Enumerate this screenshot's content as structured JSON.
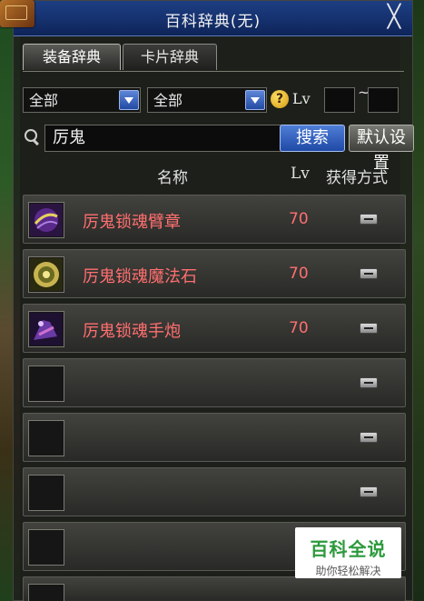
{
  "window": {
    "title": "百科辞典(无)",
    "close_glyph": "╳"
  },
  "tabs": [
    {
      "label": "装备辞典",
      "active": true
    },
    {
      "label": "卡片辞典",
      "active": false
    }
  ],
  "filters": {
    "category_1": "全部",
    "category_2": "全部",
    "help_glyph": "?",
    "lv_label": "Lv",
    "lv_min": "",
    "lv_max": "",
    "range_sep": "~"
  },
  "search": {
    "query": "厉鬼",
    "search_button": "搜索",
    "default_button": "默认设置"
  },
  "table": {
    "headers": {
      "name": "名称",
      "lv": "Lv",
      "acquire": "获得方式"
    },
    "rows": [
      {
        "name": "厉鬼锁魂臂章",
        "lv": "70",
        "icon": "armband-icon"
      },
      {
        "name": "厉鬼锁魂魔法石",
        "lv": "70",
        "icon": "magic-stone-icon"
      },
      {
        "name": "厉鬼锁魂手炮",
        "lv": "70",
        "icon": "hand-cannon-icon"
      },
      {
        "name": "",
        "lv": "",
        "icon": ""
      },
      {
        "name": "",
        "lv": "",
        "icon": ""
      },
      {
        "name": "",
        "lv": "",
        "icon": ""
      },
      {
        "name": "",
        "lv": "",
        "icon": ""
      },
      {
        "name": "",
        "lv": "",
        "icon": ""
      }
    ]
  },
  "watermark": {
    "title": "百科全说",
    "subtitle": "助你轻松解决"
  },
  "colors": {
    "titlebar": "#163270",
    "item_name": "#ff6f6f",
    "search_button": "#2a55b0",
    "watermark_green": "#2c9a3c"
  }
}
